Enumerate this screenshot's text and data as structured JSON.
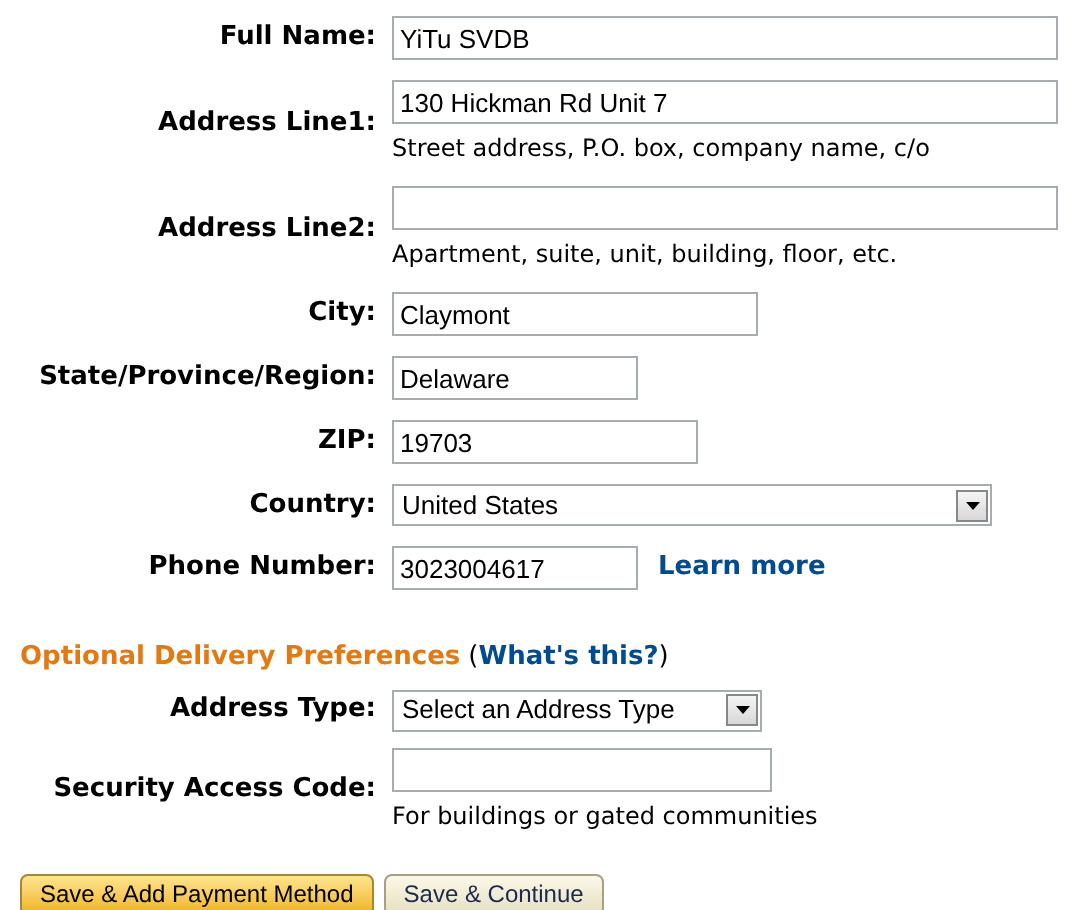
{
  "address_fields": [
    {
      "label": "Full Name:",
      "kind": "text",
      "value": "YiTu SVDB"
    },
    {
      "label": "Address Line1:",
      "kind": "text",
      "value": "130 Hickman Rd Unit 7",
      "hint": "Street address, P.O. box, company name, c/o"
    },
    {
      "label": "Address Line2:",
      "kind": "text",
      "hint": "Apartment, suite, unit, building, floor, etc."
    },
    {
      "label": "City:",
      "kind": "text",
      "value": "Claymont"
    },
    {
      "label": "State/Province/Region:",
      "kind": "text",
      "value": "Delaware"
    },
    {
      "label": "ZIP:",
      "kind": "text",
      "value": "19703"
    },
    {
      "label": "Country:",
      "kind": "select",
      "value": "United States"
    },
    {
      "label": "Phone Number:",
      "kind": "text",
      "value": "3023004617",
      "link": "Learn more"
    }
  ],
  "optional_section": {
    "title": "Optional Delivery Preferences",
    "help_link": "What's this?",
    "open_paren": "(",
    "close_paren": ")",
    "fields": [
      {
        "label": "Address Type:",
        "kind": "select",
        "value": "Select an Address Type"
      },
      {
        "label": "Security Access Code:",
        "kind": "text",
        "hint": "For buildings or gated communities"
      }
    ]
  },
  "buttons": [
    {
      "label": "Save & Add Payment Method",
      "kind": "primary"
    },
    {
      "label": "Save & Continue",
      "kind": "secondary"
    }
  ]
}
